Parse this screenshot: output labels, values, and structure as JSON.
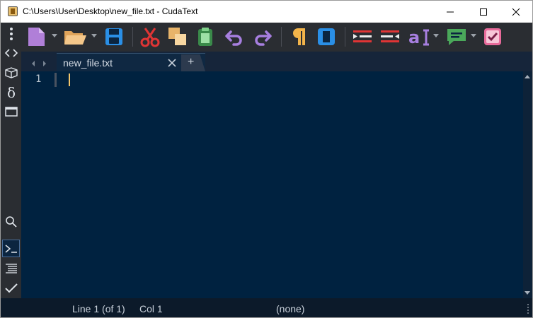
{
  "window": {
    "title": "C:\\Users\\User\\Desktop\\new_file.txt - CudaText"
  },
  "toolbar": {
    "buttons": [
      {
        "name": "new-file",
        "icon": "file-new-icon",
        "has_dropdown": true
      },
      {
        "name": "open-file",
        "icon": "folder-open-icon",
        "has_dropdown": true
      },
      {
        "name": "save",
        "icon": "floppy-save-icon"
      },
      {
        "name": "cut",
        "icon": "scissors-icon"
      },
      {
        "name": "copy",
        "icon": "copy-icon"
      },
      {
        "name": "paste",
        "icon": "clipboard-paste-icon"
      },
      {
        "name": "undo",
        "icon": "undo-icon"
      },
      {
        "name": "redo",
        "icon": "redo-icon"
      },
      {
        "name": "show-unprinted",
        "icon": "pilcrow-icon"
      },
      {
        "name": "word-wrap",
        "icon": "wrap-frame-icon"
      },
      {
        "name": "indent",
        "icon": "indent-icon"
      },
      {
        "name": "unindent",
        "icon": "unindent-icon"
      },
      {
        "name": "case",
        "icon": "text-case-icon",
        "has_dropdown": true
      },
      {
        "name": "comment",
        "icon": "comment-icon",
        "has_dropdown": true
      },
      {
        "name": "check",
        "icon": "checkbox-icon"
      }
    ]
  },
  "sidebar": {
    "items": [
      {
        "name": "menu",
        "icon": "vertical-dots-icon"
      },
      {
        "name": "code-tree",
        "icon": "code-brackets-icon"
      },
      {
        "name": "project",
        "icon": "package-icon"
      },
      {
        "name": "snippets",
        "icon": "delta-icon"
      },
      {
        "name": "tabs",
        "icon": "window-icon"
      },
      {
        "name": "search",
        "icon": "search-icon"
      },
      {
        "name": "console",
        "icon": "console-icon",
        "active": true
      },
      {
        "name": "output",
        "icon": "list-icon"
      },
      {
        "name": "validate",
        "icon": "checkmark-icon"
      }
    ]
  },
  "tabs": {
    "active": {
      "label": "new_file.txt"
    },
    "add_label": "+"
  },
  "editor": {
    "line_number": "1",
    "content": ""
  },
  "status": {
    "line": "Line 1 (of 1)",
    "col": "Col 1",
    "lexer": "(none)"
  },
  "colors": {
    "editor_bg": "#002240",
    "caret": "#f3c66c",
    "toolbar_bg": "#2a2d32"
  }
}
